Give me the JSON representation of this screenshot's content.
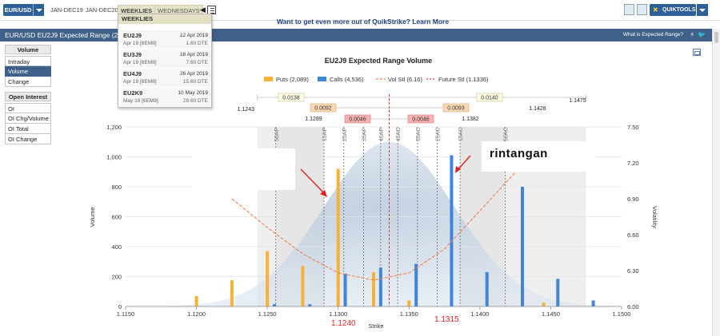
{
  "topbar": {
    "pair_label": "EUR/USD",
    "tabs": [
      "JAN-DEC19",
      "JAN-DEC20",
      "WEEKLIES",
      "WEDNESDAYS"
    ],
    "quiktools_label": "QUIKTOOLS",
    "promo": "Want to get even more out of QuikStrike? Learn More"
  },
  "titlebar": {
    "title": "EUR/USD EU2J9 Expected Range (2",
    "what_is": "What is Expected Range?"
  },
  "sidebar": {
    "volume_header": "Volume",
    "volume_items": [
      "Intraday",
      "Volume",
      "Change"
    ],
    "oi_header": "Open Interest",
    "oi_items": [
      "OI",
      "OI Chg/Volume",
      "OI Total",
      "OI Change"
    ]
  },
  "weeklies_dropdown": {
    "header": "WEEKLIES",
    "items": [
      {
        "name": "EU2J9",
        "date": "12 Apr 2019",
        "sub": "Apr 19  [6EM9]",
        "dte": "1.60 DTE"
      },
      {
        "name": "EU3J9",
        "date": "18 Apr 2019",
        "sub": "Apr 19  [6EM9]",
        "dte": "7.60 DTE"
      },
      {
        "name": "EU4J9",
        "date": "26 Apr 2019",
        "sub": "Apr 19  [6EM9]",
        "dte": "15.60 DTE"
      },
      {
        "name": "EU2K9",
        "date": "10 May 2019",
        "sub": "May 19  [6EM9]",
        "dte": "29.60 DTE"
      }
    ]
  },
  "annotations": {
    "label": "rintangan",
    "support_value": "1.1240",
    "resistance_value": "1.1315"
  },
  "chart_data": {
    "type": "bar",
    "title": "EU2J9 Expected Range Volume",
    "xlabel": "Strike",
    "ylabel": "Volume",
    "y2label": "Volatility",
    "xlim": [
      1.115,
      1.15
    ],
    "ylim": [
      0,
      1200
    ],
    "y2lim": [
      6.0,
      7.5
    ],
    "x_ticks": [
      "1.1150",
      "1.1200",
      "1.1250",
      "1.1300",
      "1.1350",
      "1.1400",
      "1.1450",
      "1.1500"
    ],
    "y_ticks": [
      "0",
      "200",
      "400",
      "600",
      "800",
      "1,000",
      "1,200"
    ],
    "y2_ticks": [
      "6.00",
      "6.30",
      "6.60",
      "6.90",
      "7.20",
      "7.50"
    ],
    "legend": [
      "Puts (2,089)",
      "Calls (4,536)",
      "Vol Stl (6.16)",
      "Future Stl (1.1336)"
    ],
    "colors": {
      "puts": "#f5b235",
      "calls": "#3f86d9",
      "vol": "#f0824e",
      "future": "#d33a3a"
    },
    "series": [
      {
        "name": "Puts",
        "x": [
          1.12,
          1.1225,
          1.125,
          1.1275,
          1.13,
          1.1325,
          1.135,
          1.1445
        ],
        "values": [
          70,
          175,
          370,
          270,
          920,
          230,
          40,
          25
        ]
      },
      {
        "name": "Calls",
        "x": [
          1.1255,
          1.128,
          1.1305,
          1.133,
          1.1355,
          1.138,
          1.1405,
          1.143,
          1.1455,
          1.148
        ],
        "values": [
          15,
          15,
          220,
          260,
          285,
          1010,
          230,
          800,
          185,
          40
        ]
      }
    ],
    "vol_curve": {
      "x": [
        1.1225,
        1.125,
        1.1275,
        1.13,
        1.1325,
        1.135,
        1.1375,
        1.14,
        1.1425
      ],
      "values": [
        6.9,
        6.66,
        6.44,
        6.28,
        6.22,
        6.28,
        6.48,
        6.8,
        7.12
      ]
    },
    "future_settle": 1.1336,
    "strike_labels": [
      {
        "label": "50AP",
        "x": 1.1256
      },
      {
        "label": "15AP",
        "x": 1.129
      },
      {
        "label": "25AP",
        "x": 1.1304
      },
      {
        "label": "35AP",
        "x": 1.1318
      },
      {
        "label": "45AP",
        "x": 1.133
      },
      {
        "label": "45AC",
        "x": 1.1342
      },
      {
        "label": "35AC",
        "x": 1.1356
      },
      {
        "label": "25AC",
        "x": 1.137
      },
      {
        "label": "15AC",
        "x": 1.1386
      },
      {
        "label": "50AC",
        "x": 1.1418
      }
    ],
    "range_boxes": [
      {
        "label": "0.0138",
        "row": 1,
        "color": "yellow"
      },
      {
        "label": "0.0140",
        "row": 1,
        "color": "yellow"
      },
      {
        "label": "0.0092",
        "row": 2,
        "color": "orange"
      },
      {
        "label": "0.0093",
        "row": 2,
        "color": "orange"
      },
      {
        "label": "0.0046",
        "row": 3,
        "color": "red"
      },
      {
        "label": "0.0046",
        "row": 3,
        "color": "red"
      }
    ],
    "range_values": [
      "1.1243",
      "1.1475",
      "1.1289",
      "1.1382",
      "1.1428"
    ]
  }
}
